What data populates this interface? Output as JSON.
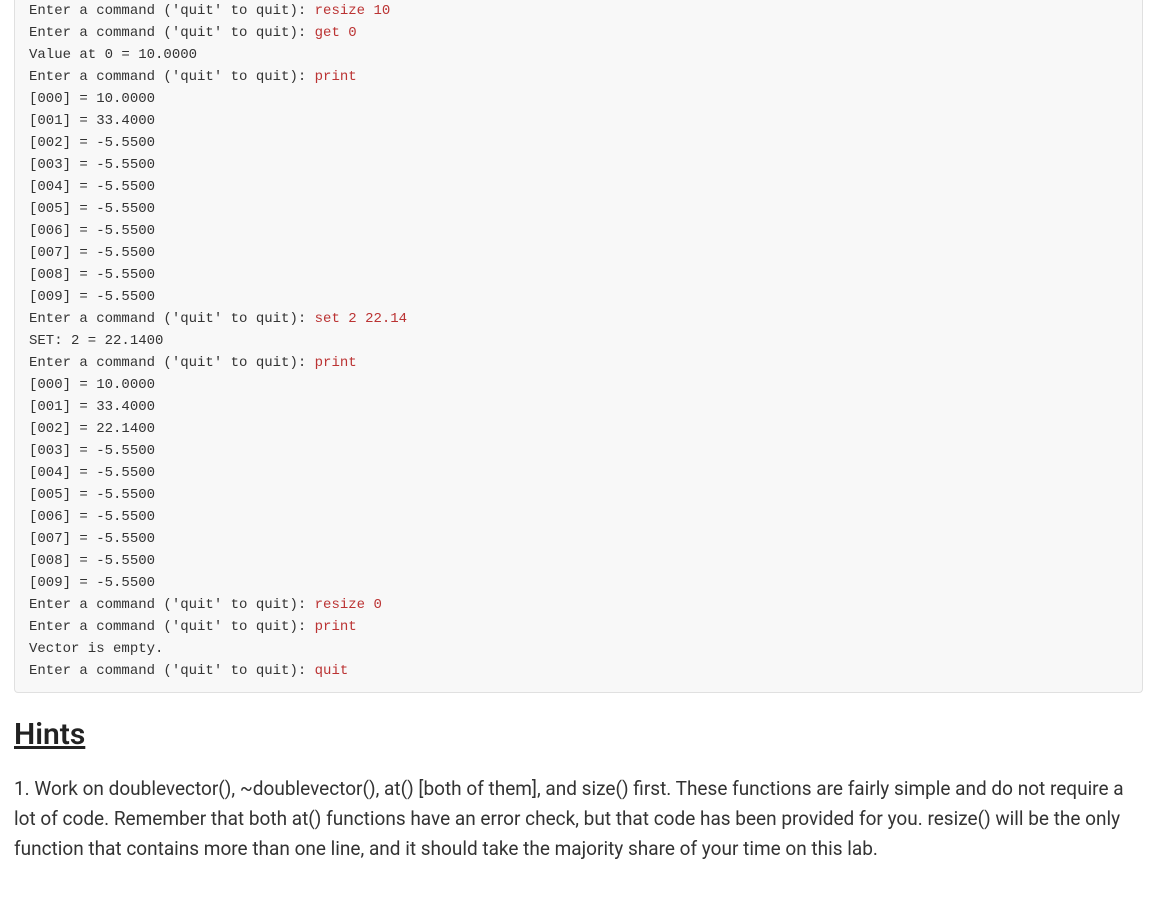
{
  "code": {
    "prompt_prefix": "Enter a command ('quit' to quit): ",
    "lines": [
      {
        "type": "prompt",
        "cmd": "resize 10"
      },
      {
        "type": "prompt",
        "cmd": "get 0"
      },
      {
        "type": "output",
        "text": "Value at 0 = 10.0000"
      },
      {
        "type": "prompt",
        "cmd": "print"
      },
      {
        "type": "output",
        "text": "[000] = 10.0000"
      },
      {
        "type": "output",
        "text": "[001] = 33.4000"
      },
      {
        "type": "output",
        "text": "[002] = -5.5500"
      },
      {
        "type": "output",
        "text": "[003] = -5.5500"
      },
      {
        "type": "output",
        "text": "[004] = -5.5500"
      },
      {
        "type": "output",
        "text": "[005] = -5.5500"
      },
      {
        "type": "output",
        "text": "[006] = -5.5500"
      },
      {
        "type": "output",
        "text": "[007] = -5.5500"
      },
      {
        "type": "output",
        "text": "[008] = -5.5500"
      },
      {
        "type": "output",
        "text": "[009] = -5.5500"
      },
      {
        "type": "prompt",
        "cmd": "set 2 22.14"
      },
      {
        "type": "output",
        "text": "SET: 2 = 22.1400"
      },
      {
        "type": "prompt",
        "cmd": "print"
      },
      {
        "type": "output",
        "text": "[000] = 10.0000"
      },
      {
        "type": "output",
        "text": "[001] = 33.4000"
      },
      {
        "type": "output",
        "text": "[002] = 22.1400"
      },
      {
        "type": "output",
        "text": "[003] = -5.5500"
      },
      {
        "type": "output",
        "text": "[004] = -5.5500"
      },
      {
        "type": "output",
        "text": "[005] = -5.5500"
      },
      {
        "type": "output",
        "text": "[006] = -5.5500"
      },
      {
        "type": "output",
        "text": "[007] = -5.5500"
      },
      {
        "type": "output",
        "text": "[008] = -5.5500"
      },
      {
        "type": "output",
        "text": "[009] = -5.5500"
      },
      {
        "type": "prompt",
        "cmd": "resize 0"
      },
      {
        "type": "prompt",
        "cmd": "print"
      },
      {
        "type": "output",
        "text": "Vector is empty."
      },
      {
        "type": "prompt",
        "cmd": "quit"
      }
    ]
  },
  "hints": {
    "heading": "Hints",
    "paragraph": "1. Work on doublevector(), ~doublevector(), at() [both of them], and size() first. These functions are fairly simple and do not require a lot of code. Remember that both at() functions have an error check, but that code has been provided for you. resize() will be the only function that contains more than one line, and it should take the majority share of your time on this lab."
  }
}
